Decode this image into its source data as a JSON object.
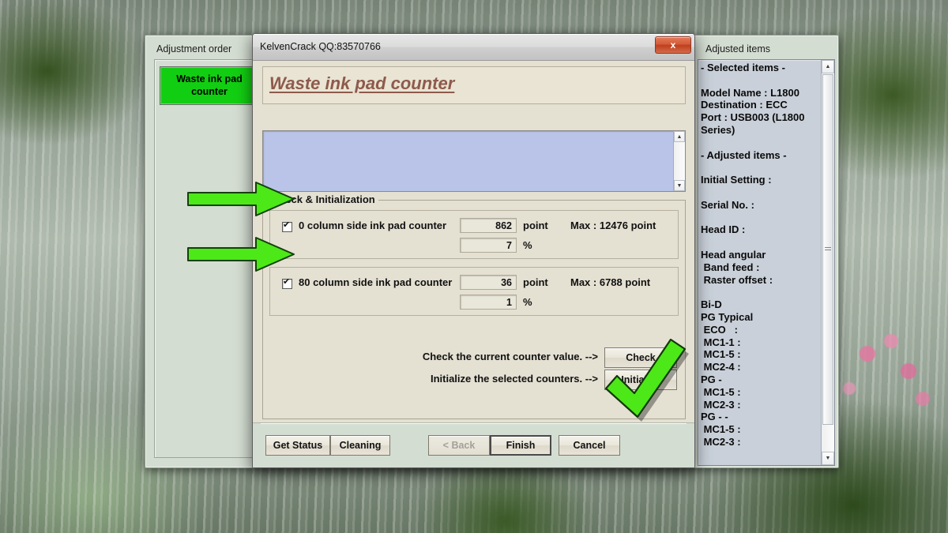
{
  "back_window": {
    "left_label": "Adjustment order",
    "right_label": "Adjusted items",
    "order_items": [
      {
        "label": "Waste ink pad counter",
        "selected": true
      }
    ],
    "adjusted_items_text": "- Selected items -\n\nModel Name : L1800\nDestination : ECC\nPort : USB003 (L1800\nSeries)\n\n- Adjusted items -\n\nInitial Setting :\n\nSerial No. :\n\nHead ID :\n\nHead angular\n Band feed :\n Raster offset :\n\nBi-D\nPG Typical\n ECO   :\n MC1-1 :\n MC1-5 :\n MC2-4 :\nPG -\n MC1-5 :\n MC2-3 :\nPG - -\n MC1-5 :\n MC2-3 :"
  },
  "dialog": {
    "title": "KelvenCrack  QQ:83570766",
    "close_label": "x",
    "page_title": "Waste ink pad counter",
    "message_text": "",
    "group_legend": "Check & Initialization",
    "counters": [
      {
        "id": "0-column",
        "checked": true,
        "label": "0 column side ink pad counter",
        "point_value": "862",
        "point_unit": "point",
        "percent_value": "7",
        "percent_unit": "%",
        "max_label": "Max : 12476 point"
      },
      {
        "id": "80-column",
        "checked": true,
        "label": "80 column side ink pad counter",
        "point_value": "36",
        "point_unit": "point",
        "percent_value": "1",
        "percent_unit": "%",
        "max_label": "Max : 6788 point"
      }
    ],
    "actions": [
      {
        "text": "Check the current counter value. -->",
        "button": "Check"
      },
      {
        "text": "Initialize the selected counters. -->",
        "button": "Initialize"
      }
    ],
    "buttons": {
      "get_status": "Get Status",
      "cleaning": "Cleaning",
      "back": "< Back",
      "finish": "Finish",
      "cancel": "Cancel"
    }
  },
  "annotations": {
    "arrow_color": "#4CE817",
    "check_color": "#4CE817",
    "arrow_outline": "#1d4d12"
  },
  "colors": {
    "dialog_background": "#E4E0D2",
    "window_background": "#D4DDD2",
    "message_background": "#B9C4E8",
    "selected_item": "#12CE12",
    "page_title": "#8E5A4C",
    "close_button": "#D35A38"
  }
}
